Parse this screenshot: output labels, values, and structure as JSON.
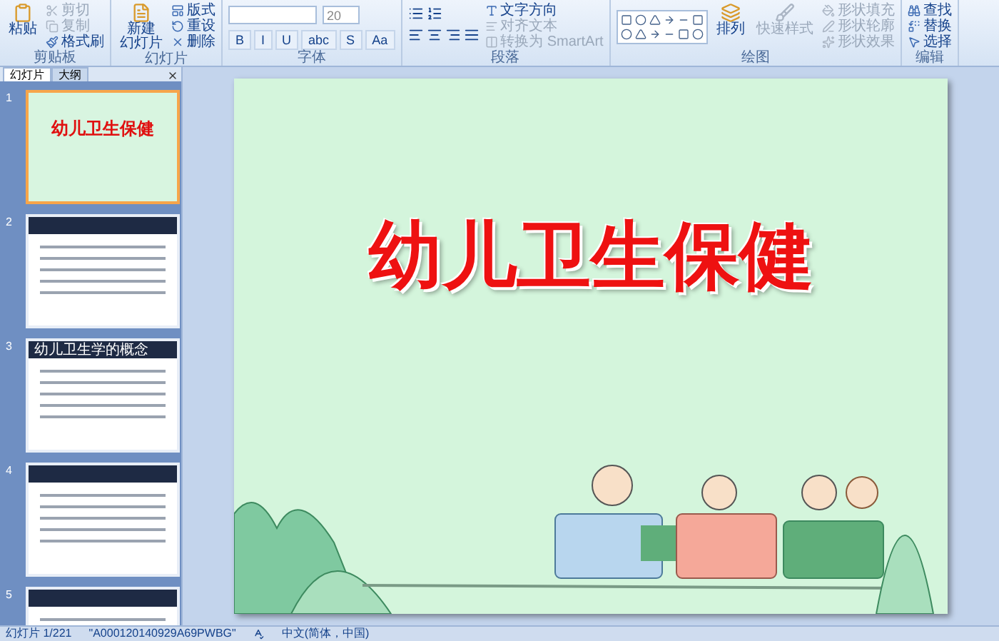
{
  "ribbon": {
    "groups": [
      {
        "label": "剪贴板",
        "large": [
          {
            "lines": [
              "粘贴"
            ],
            "disabled": false
          }
        ],
        "small": [
          {
            "label": "剪切",
            "disabled": true
          },
          {
            "label": "复制",
            "disabled": true
          },
          {
            "label": "格式刷",
            "disabled": false
          }
        ]
      },
      {
        "label": "幻灯片",
        "large": [
          {
            "lines": [
              "新建",
              "幻灯片"
            ],
            "disabled": false
          }
        ],
        "small": [
          {
            "label": "版式",
            "disabled": false
          },
          {
            "label": "重设",
            "disabled": false
          },
          {
            "label": "删除",
            "disabled": false
          }
        ]
      },
      {
        "label": "字体",
        "size_field": {
          "value": "20"
        },
        "format_buttons": [
          "B",
          "I",
          "U",
          "abc",
          "S",
          "Aa"
        ]
      },
      {
        "label": "段落",
        "small": [
          {
            "label": "文字方向",
            "disabled": false
          },
          {
            "label": "对齐文本",
            "disabled": true
          },
          {
            "label": "转换为 SmartArt",
            "disabled": true
          }
        ]
      },
      {
        "label": "绘图",
        "large": [
          {
            "lines": [
              "排列"
            ],
            "disabled": false
          },
          {
            "lines": [
              "快速样式"
            ],
            "disabled": true
          }
        ],
        "small": [
          {
            "label": "形状填充",
            "disabled": true
          },
          {
            "label": "形状轮廓",
            "disabled": true
          },
          {
            "label": "形状效果",
            "disabled": true
          }
        ]
      },
      {
        "label": "编辑",
        "small": [
          {
            "label": "查找",
            "disabled": false
          },
          {
            "label": "替换",
            "disabled": false
          },
          {
            "label": "选择",
            "disabled": false
          }
        ]
      }
    ]
  },
  "panel": {
    "tabs": [
      {
        "label": "幻灯片",
        "selected": true
      },
      {
        "label": "大纲",
        "selected": false
      }
    ],
    "slides": [
      {
        "number": "1",
        "kind": "title",
        "title": "幼儿卫生保健",
        "selected": true
      },
      {
        "number": "2",
        "kind": "content",
        "selected": false
      },
      {
        "number": "3",
        "kind": "content",
        "title": "幼儿卫生学的概念",
        "selected": false
      },
      {
        "number": "4",
        "kind": "content",
        "selected": false
      },
      {
        "number": "5",
        "kind": "content",
        "selected": false
      }
    ]
  },
  "slide": {
    "title": "幼儿卫生保健"
  },
  "status_bar": {
    "slide": "幻灯片 1/221",
    "theme": "\"A000120140929A69PWBG\"",
    "language": "中文(简体，中国)"
  }
}
